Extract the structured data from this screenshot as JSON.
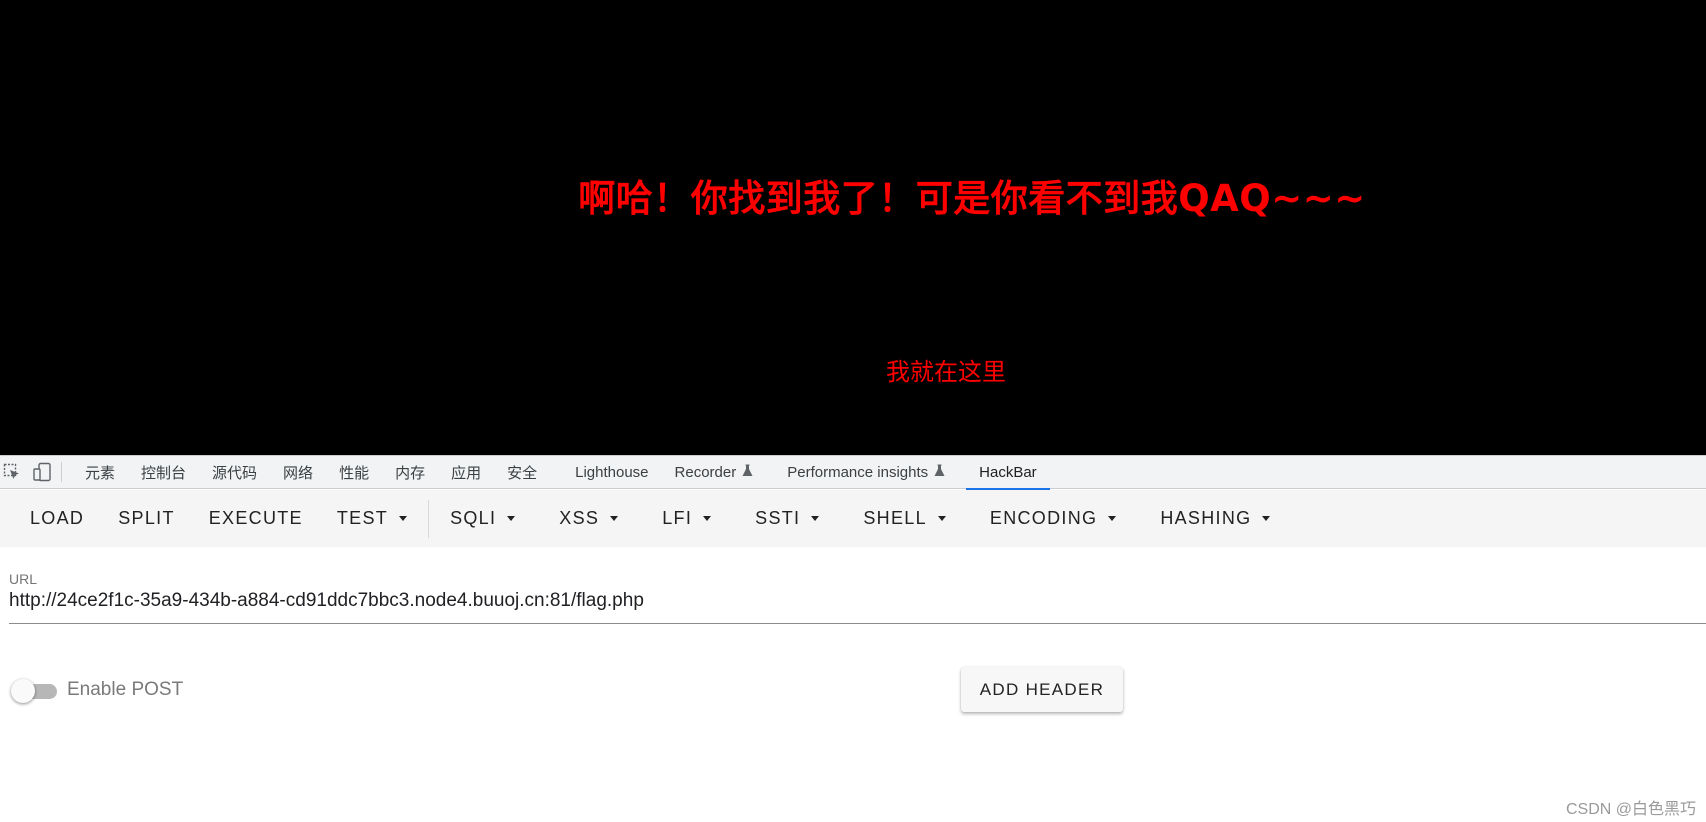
{
  "page": {
    "headline": "啊哈！你找到我了！可是你看不到我QAQ~~~",
    "link_text": "我就在这里",
    "colors": {
      "background": "#000000",
      "text": "#ff0000"
    }
  },
  "devtools": {
    "icons": [
      "inspect-element-icon",
      "device-toolbar-icon"
    ],
    "tabs": [
      {
        "label": "元素",
        "icon": ""
      },
      {
        "label": "控制台",
        "icon": ""
      },
      {
        "label": "源代码",
        "icon": ""
      },
      {
        "label": "网络",
        "icon": ""
      },
      {
        "label": "性能",
        "icon": ""
      },
      {
        "label": "内存",
        "icon": ""
      },
      {
        "label": "应用",
        "icon": ""
      },
      {
        "label": "安全",
        "icon": ""
      },
      {
        "label": "Lighthouse",
        "icon": ""
      },
      {
        "label": "Recorder",
        "icon": "flask-icon"
      },
      {
        "label": "Performance insights",
        "icon": "flask-icon"
      },
      {
        "label": "HackBar",
        "icon": "",
        "active": true
      }
    ],
    "accent": "#1a73e8"
  },
  "hackbar": {
    "toolbar": {
      "buttons": [
        {
          "label": "LOAD",
          "dropdown": false
        },
        {
          "label": "SPLIT",
          "dropdown": false
        },
        {
          "label": "EXECUTE",
          "dropdown": false
        },
        {
          "label": "TEST",
          "dropdown": true
        },
        {
          "label": "SQLI",
          "dropdown": true
        },
        {
          "label": "XSS",
          "dropdown": true
        },
        {
          "label": "LFI",
          "dropdown": true
        },
        {
          "label": "SSTI",
          "dropdown": true
        },
        {
          "label": "SHELL",
          "dropdown": true
        },
        {
          "label": "ENCODING",
          "dropdown": true
        },
        {
          "label": "HASHING",
          "dropdown": true
        }
      ]
    },
    "url": {
      "label": "URL",
      "value": "http://24ce2f1c-35a9-434b-a884-cd91ddc7bbc3.node4.buuoj.cn:81/flag.php"
    },
    "post_toggle": {
      "label": "Enable POST",
      "enabled": false
    },
    "add_header_label": "ADD HEADER"
  },
  "watermark": "CSDN @白色黑巧"
}
